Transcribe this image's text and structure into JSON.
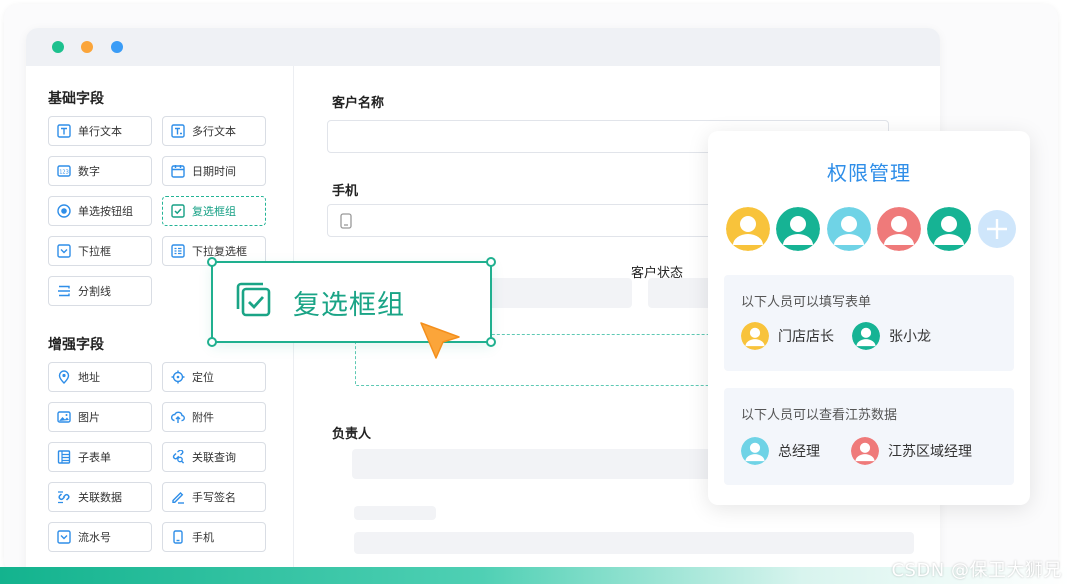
{
  "sidebar": {
    "basic_title": "基础字段",
    "enhanced_title": "增强字段",
    "basic_fields": [
      {
        "label": "单行文本",
        "icon": "single-line-text-icon"
      },
      {
        "label": "多行文本",
        "icon": "multi-line-text-icon"
      },
      {
        "label": "数字",
        "icon": "number-icon"
      },
      {
        "label": "日期时间",
        "icon": "calendar-icon"
      },
      {
        "label": "单选按钮组",
        "icon": "radio-icon"
      },
      {
        "label": "复选框组",
        "icon": "checkbox-icon"
      },
      {
        "label": "下拉框",
        "icon": "dropdown-icon"
      },
      {
        "label": "下拉复选框",
        "icon": "dropdown-checkbox-icon"
      },
      {
        "label": "分割线",
        "icon": "divider-icon"
      }
    ],
    "enhanced_fields": [
      {
        "label": "地址",
        "icon": "location-pin-icon"
      },
      {
        "label": "定位",
        "icon": "crosshair-icon"
      },
      {
        "label": "图片",
        "icon": "image-icon"
      },
      {
        "label": "附件",
        "icon": "cloud-upload-icon"
      },
      {
        "label": "子表单",
        "icon": "subform-icon"
      },
      {
        "label": "关联查询",
        "icon": "link-search-icon"
      },
      {
        "label": "关联数据",
        "icon": "link-data-icon"
      },
      {
        "label": "手写签名",
        "icon": "pen-icon"
      },
      {
        "label": "流水号",
        "icon": "serial-number-icon"
      },
      {
        "label": "手机",
        "icon": "mobile-phone-icon"
      }
    ]
  },
  "form": {
    "customer_name_label": "客户名称",
    "phone_label": "手机",
    "customer_status_label": "客户状态",
    "owner_label": "负责人"
  },
  "drag": {
    "label": "复选框组",
    "icon": "checkbox-icon"
  },
  "permission": {
    "title": "权限管理",
    "avatar_colors": [
      "#f8c33b",
      "#16b394",
      "#6fd3e6",
      "#ef7a7a",
      "#16b394"
    ],
    "fill_group": {
      "heading": "以下人员可以填写表单",
      "people": [
        {
          "name": "门店店长",
          "color": "#f8c33b"
        },
        {
          "name": "张小龙",
          "color": "#16b394"
        }
      ]
    },
    "view_group": {
      "heading": "以下人员可以查看江苏数据",
      "people": [
        {
          "name": "总经理",
          "color": "#6fd3e6"
        },
        {
          "name": "江苏区域经理",
          "color": "#ef7a7a"
        }
      ]
    }
  },
  "watermark": "CSDN @保卫大狮兄",
  "colors": {
    "accent_green": "#20b08f",
    "accent_blue": "#2f8ee8",
    "cursor_orange": "#fba53a"
  }
}
